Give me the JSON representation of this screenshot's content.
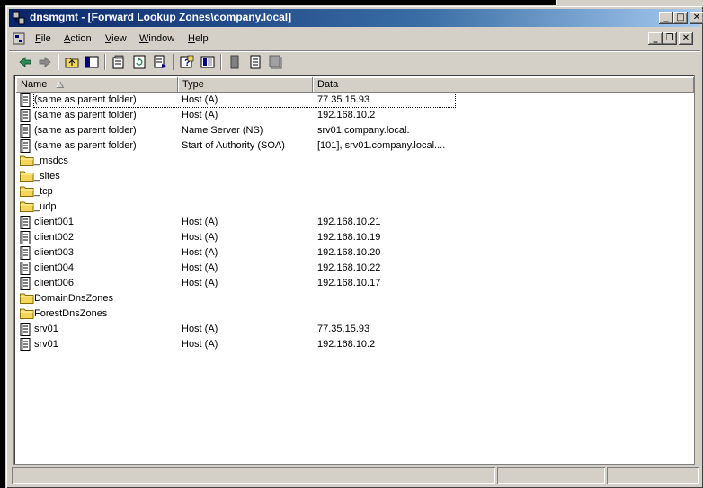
{
  "window": {
    "title": "dnsmgmt - [Forward Lookup Zones\\company.local]",
    "caption_buttons": {
      "minimize": "_",
      "maximize": "□",
      "close": "✕"
    },
    "inner_buttons": {
      "minimize": "_",
      "restore": "❐",
      "close": "✕"
    }
  },
  "menu": [
    {
      "label": "File",
      "accel": "F"
    },
    {
      "label": "Action",
      "accel": "A"
    },
    {
      "label": "View",
      "accel": "V"
    },
    {
      "label": "Window",
      "accel": "W"
    },
    {
      "label": "Help",
      "accel": "H"
    }
  ],
  "toolbar": {
    "icons": [
      "back-arrow-icon",
      "forward-arrow-icon",
      "up-folder-icon",
      "show-hide-tree-icon",
      "properties-icon",
      "refresh-icon",
      "export-list-icon",
      "help-icon",
      "console-tree-icon",
      "zone-icon",
      "host-record-icon",
      "server-icon"
    ]
  },
  "columns": {
    "name": "Name",
    "type": "Type",
    "data": "Data"
  },
  "records": [
    {
      "name": "(same as parent folder)",
      "type": "Host (A)",
      "data": "77.35.15.93",
      "icon": "record"
    },
    {
      "name": "(same as parent folder)",
      "type": "Host (A)",
      "data": "192.168.10.2",
      "icon": "record"
    },
    {
      "name": "(same as parent folder)",
      "type": "Name Server (NS)",
      "data": "srv01.company.local.",
      "icon": "record"
    },
    {
      "name": "(same as parent folder)",
      "type": "Start of Authority (SOA)",
      "data": "[101], srv01.company.local....",
      "icon": "record"
    },
    {
      "name": "_msdcs",
      "type": "",
      "data": "",
      "icon": "folder"
    },
    {
      "name": "_sites",
      "type": "",
      "data": "",
      "icon": "folder"
    },
    {
      "name": "_tcp",
      "type": "",
      "data": "",
      "icon": "folder"
    },
    {
      "name": "_udp",
      "type": "",
      "data": "",
      "icon": "folder"
    },
    {
      "name": "client001",
      "type": "Host (A)",
      "data": "192.168.10.21",
      "icon": "record"
    },
    {
      "name": "client002",
      "type": "Host (A)",
      "data": "192.168.10.19",
      "icon": "record"
    },
    {
      "name": "client003",
      "type": "Host (A)",
      "data": "192.168.10.20",
      "icon": "record"
    },
    {
      "name": "client004",
      "type": "Host (A)",
      "data": "192.168.10.22",
      "icon": "record"
    },
    {
      "name": "client006",
      "type": "Host (A)",
      "data": "192.168.10.17",
      "icon": "record"
    },
    {
      "name": "DomainDnsZones",
      "type": "",
      "data": "",
      "icon": "folder"
    },
    {
      "name": "ForestDnsZones",
      "type": "",
      "data": "",
      "icon": "folder"
    },
    {
      "name": "srv01",
      "type": "Host (A)",
      "data": "77.35.15.93",
      "icon": "record"
    },
    {
      "name": "srv01",
      "type": "Host (A)",
      "data": "192.168.10.2",
      "icon": "record"
    }
  ],
  "colors": {
    "title_start": "#0a246a",
    "title_end": "#a6caf0",
    "face": "#d4d0c8",
    "folder": "#f4d65a"
  }
}
